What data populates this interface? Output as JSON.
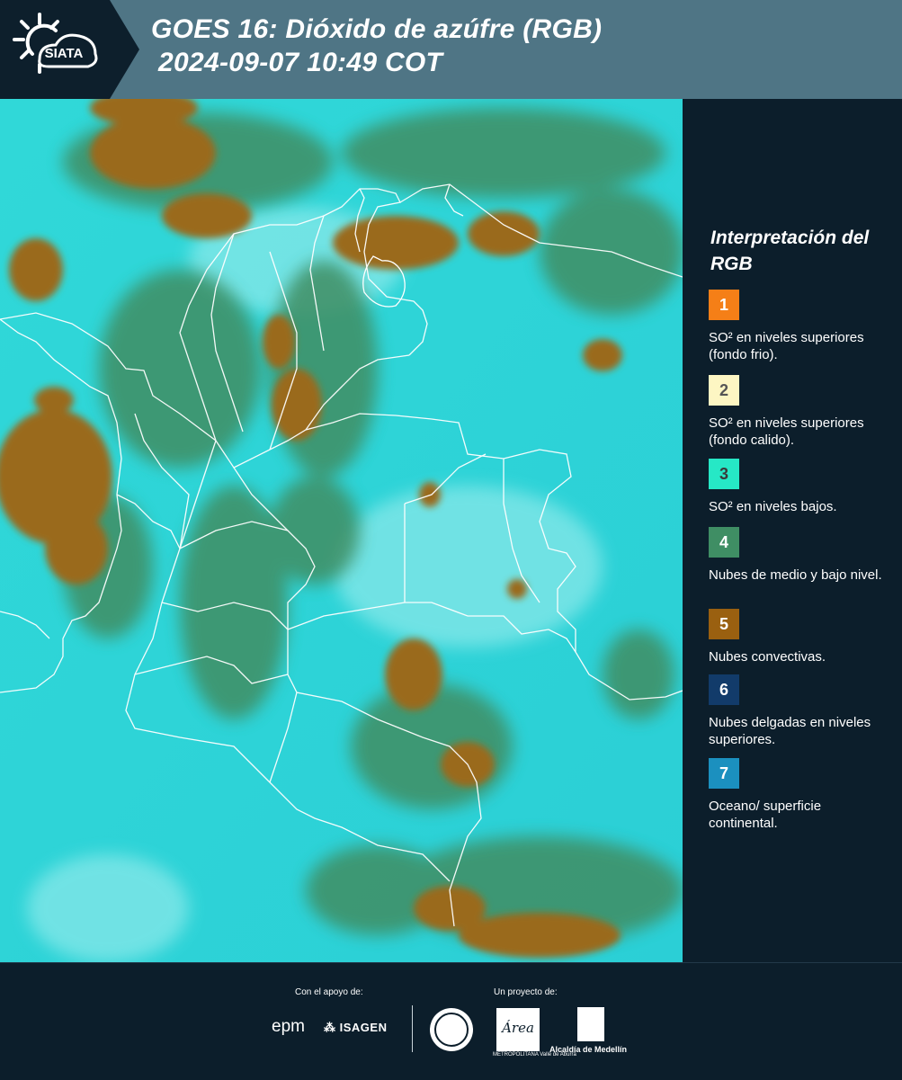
{
  "header": {
    "brand": "SIATA",
    "title_line1": "GOES 16: Dióxido de azúfre (RGB)",
    "title_line2": "2024-09-07 10:49 COT"
  },
  "legend": {
    "title": "Interpretación del RGB",
    "items": [
      {
        "number": "1",
        "color": "#f57f17",
        "text_color": "#ffffff",
        "label": "SO² en niveles superiores (fondo frio)."
      },
      {
        "number": "2",
        "color": "#fdf6c3",
        "text_color": "#555555",
        "label": "SO² en niveles superiores (fondo calido)."
      },
      {
        "number": "3",
        "color": "#26e8c6",
        "text_color": "#3a3a3a",
        "label": "SO² en niveles bajos."
      },
      {
        "number": "4",
        "color": "#3f8e64",
        "text_color": "#ffffff",
        "label": "Nubes de medio y bajo nivel."
      },
      {
        "number": "5",
        "color": "#9a6010",
        "text_color": "#ffffff",
        "label": "Nubes convectivas."
      },
      {
        "number": "6",
        "color": "#123b6a",
        "text_color": "#ffffff",
        "label": "Nubes delgadas en niveles superiores."
      },
      {
        "number": "7",
        "color": "#1b90bf",
        "text_color": "#ffffff",
        "label": "Oceano/ superficie continental."
      }
    ]
  },
  "footer": {
    "support_label": "Con el apoyo de:",
    "project_label": "Un proyecto de:",
    "sponsor1": "epm",
    "sponsor2": "ISAGEN",
    "partner_area": "Área",
    "partner_area_caption": "METROPOLITANA Valle de Aburrá",
    "partner_alcaldia": "Alcaldía de Medellín"
  },
  "colors": {
    "header_bg": "#4f7585",
    "panel_bg": "#0c1e2b",
    "map_cyan": "#29d4d6",
    "map_green": "#3f8e64",
    "map_brown": "#9a6a1c"
  }
}
